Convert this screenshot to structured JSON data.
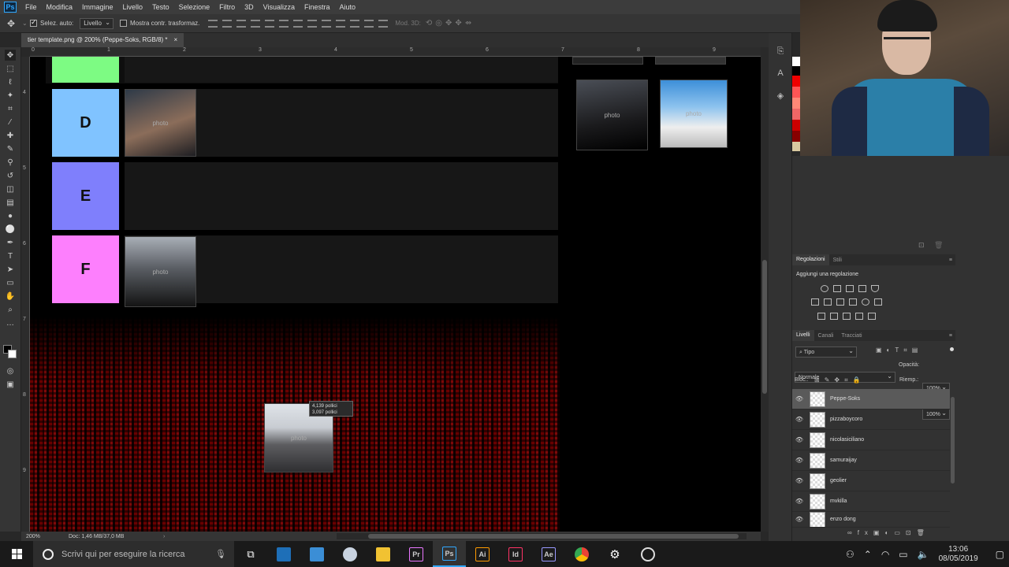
{
  "menubar": {
    "items": [
      "File",
      "Modifica",
      "Immagine",
      "Livello",
      "Testo",
      "Selezione",
      "Filtro",
      "3D",
      "Visualizza",
      "Finestra",
      "Aiuto"
    ]
  },
  "options": {
    "autoselect_label": "Selez. auto:",
    "autoselect_value": "Livello",
    "transform_label": "Mostra contr. trasformaz.",
    "mode3d_label": "Mod. 3D:"
  },
  "document": {
    "tab_title": "tier template.png @ 200% (Peppe-Soks, RGB/8) *",
    "tab_close": "×"
  },
  "ruler": {
    "top": [
      "0",
      "1",
      "2",
      "3",
      "4",
      "5",
      "6",
      "7",
      "8",
      "9"
    ],
    "left": [
      "4",
      "5",
      "6",
      "7",
      "8",
      "9"
    ]
  },
  "tiers": [
    {
      "label": "",
      "color": "#7dfb83"
    },
    {
      "label": "D",
      "color": "#80c3ff"
    },
    {
      "label": "E",
      "color": "#7f7ffc"
    },
    {
      "label": "F",
      "color": "#fd7ffd"
    }
  ],
  "drag_tooltip": {
    "line1": "4,139 pollici",
    "line2": "3,097 pollici"
  },
  "status": {
    "zoom": "200%",
    "doc": "Doc: 1,46 MB/37,0 MB"
  },
  "panels": {
    "adjust_tabs": [
      "Regolazioni",
      "Stili"
    ],
    "adjust_title": "Aggiungi una regolazione",
    "layers_tabs": [
      "Livelli",
      "Canali",
      "Tracciati"
    ],
    "filter_kind": "Tipo",
    "blend_mode": "Normale",
    "opacity_label": "Opacità:",
    "opacity_value": "100%",
    "lock_label": "Bloc.:",
    "fill_label": "Riemp.:",
    "fill_value": "100%",
    "layers": [
      {
        "name": "Peppe-Soks",
        "active": true
      },
      {
        "name": "pizzaboycoro",
        "active": false
      },
      {
        "name": "nicolasiciliano",
        "active": false
      },
      {
        "name": "samuraijay",
        "active": false
      },
      {
        "name": "geolier",
        "active": false
      },
      {
        "name": "mvkilla",
        "active": false
      },
      {
        "name": "enzo dong",
        "active": false
      }
    ]
  },
  "taskbar": {
    "search_placeholder": "Scrivi qui per eseguire la ricerca",
    "apps": [
      {
        "label": "Pr",
        "color": "#ea77ff",
        "bg": "#2a0a3a"
      },
      {
        "label": "Ps",
        "color": "#31a8ff",
        "bg": "#0a2840"
      },
      {
        "label": "Ai",
        "color": "#ff9a00",
        "bg": "#3a1e00"
      },
      {
        "label": "Id",
        "color": "#ff3366",
        "bg": "#3a0a18"
      },
      {
        "label": "Ae",
        "color": "#9999ff",
        "bg": "#1a1a40"
      }
    ],
    "time": "13:06",
    "date": "08/05/2019"
  },
  "photos": {
    "tier_d": "photo",
    "tier_f": "photo",
    "dragged": "photo",
    "side1": "photo",
    "side2": "photo"
  }
}
